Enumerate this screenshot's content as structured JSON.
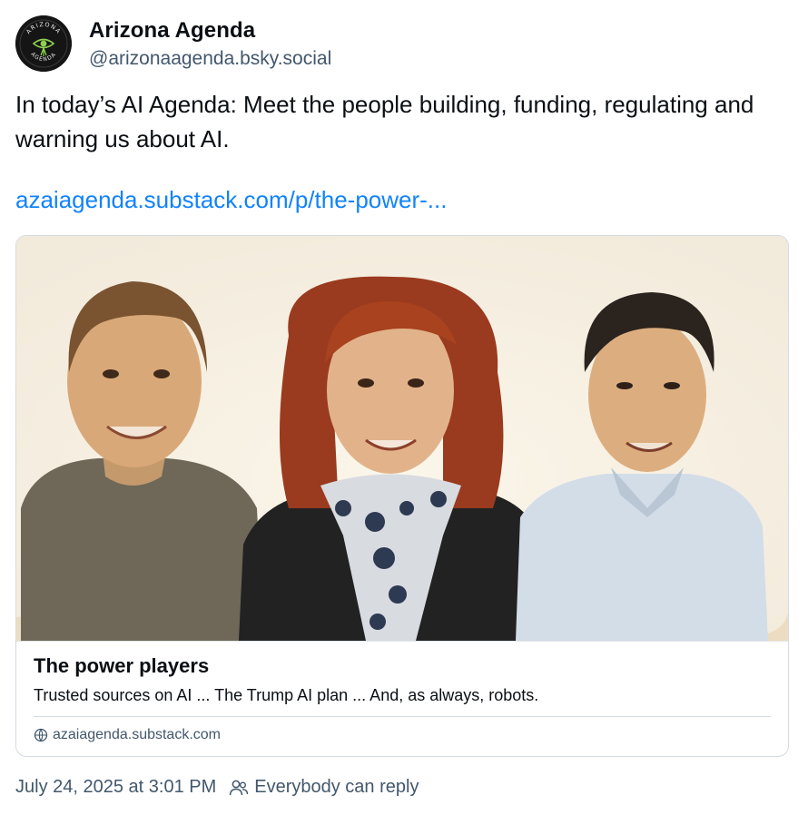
{
  "author": {
    "name": "Arizona Agenda",
    "handle": "@arizonaagenda.bsky.social",
    "avatar_icon": "arizona-agenda-logo",
    "avatar_text_top": "ARIZONA",
    "avatar_text_bottom": "AGENDA"
  },
  "post": {
    "text": "In today’s AI Agenda: Meet the people building, funding, regulating and warning us about AI.",
    "link_text": "azaiagenda.substack.com/p/the-power-..."
  },
  "card": {
    "title": "The power players",
    "description": "Trusted sources on AI ... The Trump AI plan ... And, as always, robots.",
    "domain": "azaiagenda.substack.com",
    "domain_icon": "globe-icon"
  },
  "meta": {
    "timestamp": "July 24, 2025 at 3:01 PM",
    "reply_setting": "Everybody can reply",
    "reply_icon": "people-icon"
  },
  "colors": {
    "link": "#1083fe",
    "secondary_text": "#42576c",
    "border": "#d4dbe2"
  }
}
